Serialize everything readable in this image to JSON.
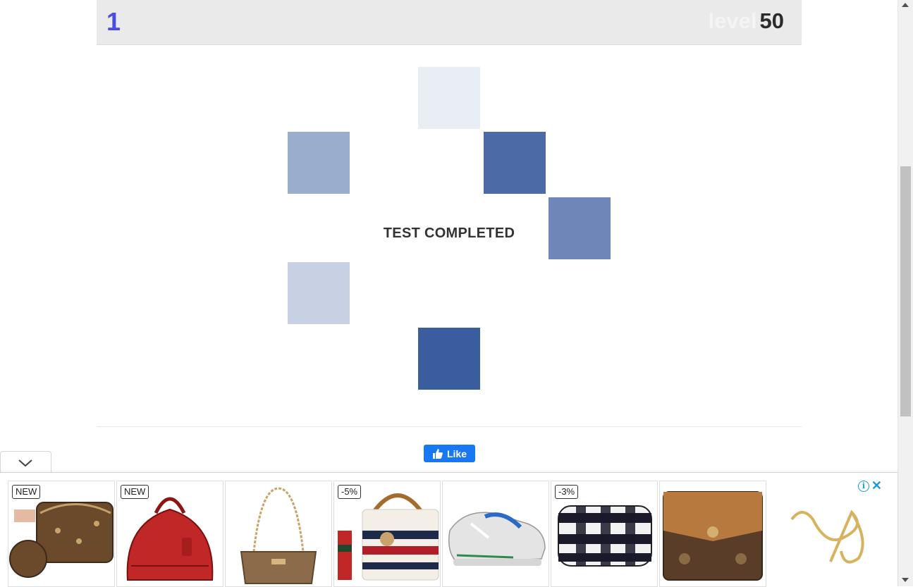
{
  "header": {
    "score": "1",
    "level_label": "level",
    "level_value": "50"
  },
  "game": {
    "result_text": "TEST COMPLETED",
    "tile_colors": {
      "t1": "#e9edf4",
      "t2": "#9aadcc",
      "t3": "#4c6aa5",
      "t4": "#6e86b8",
      "t5": "#c8d1e4",
      "t6": "#3a5d9f"
    }
  },
  "social": {
    "like_label": "Like"
  },
  "ad": {
    "products": [
      {
        "badge": "NEW",
        "icon": "multi-pochette-bag-icon"
      },
      {
        "badge": "NEW",
        "icon": "red-handbag-icon"
      },
      {
        "badge": "",
        "icon": "shoulder-bag-icon"
      },
      {
        "badge": "-5%",
        "icon": "bamboo-handle-bag-icon"
      },
      {
        "badge": "",
        "icon": "sneaker-icon"
      },
      {
        "badge": "-3%",
        "icon": "plaid-pouch-icon"
      },
      {
        "badge": "",
        "icon": "monogram-wallet-icon"
      }
    ],
    "info_icon": "i",
    "close_icon": "✕"
  },
  "colors": {
    "accent": "#4a4de0",
    "facebook": "#1877f2",
    "ad_accent": "#1a9cd8"
  }
}
